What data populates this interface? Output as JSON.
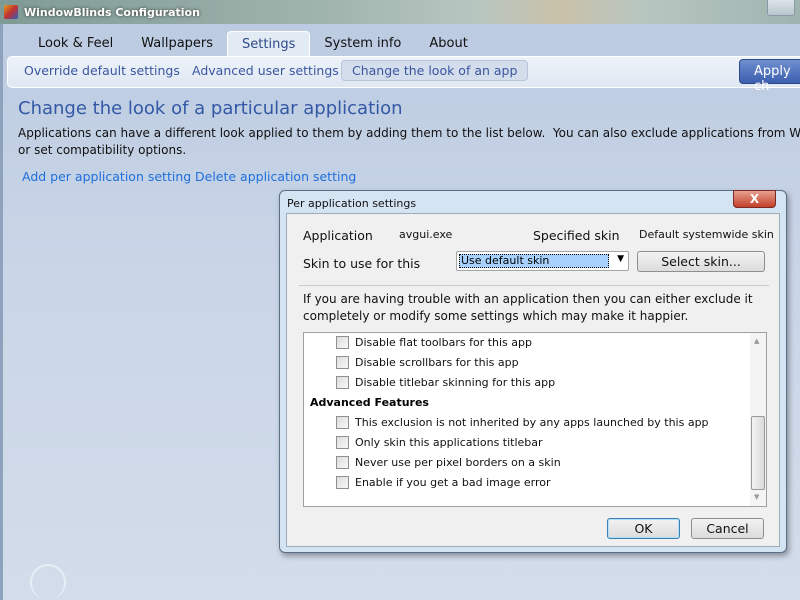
{
  "window": {
    "title": "WindowBlinds Configuration"
  },
  "tabs": [
    "Look & Feel",
    "Wallpapers",
    "Settings",
    "System info",
    "About"
  ],
  "subtabs": [
    "Override default settings",
    "Advanced user settings",
    "Change the look of an app"
  ],
  "apply_label": "Apply ch",
  "page": {
    "title": "Change the look of a particular application",
    "description": "Applications can have a different look applied to them by adding them to the list below.  You can also exclude applications from Window\nor set compatibility options.",
    "links": [
      "Add per application setting",
      "Delete application setting"
    ]
  },
  "dialog": {
    "title": "Per application settings",
    "close": "X",
    "application_label": "Application",
    "application_value": "avgui.exe",
    "specified_skin_label": "Specified skin",
    "specified_skin_value": "Default systemwide skin",
    "skin_label": "Skin to use for this application",
    "skin_select": "Use default skin",
    "select_skin_button": "Select skin...",
    "help": "If you are having trouble with an application then you can either exclude it\ncompletely or modify some settings which may make it happier.",
    "options": [
      "Disable flat toolbars for this app",
      "Disable scrollbars for this app",
      "Disable titlebar skinning for this app"
    ],
    "section": "Advanced Features",
    "advanced": [
      "This exclusion is not inherited by any apps launched by this app",
      "Only skin this applications titlebar",
      "Never use per pixel borders on a skin",
      "Enable if you get a bad image error"
    ],
    "ok": "OK",
    "cancel": "Cancel"
  }
}
